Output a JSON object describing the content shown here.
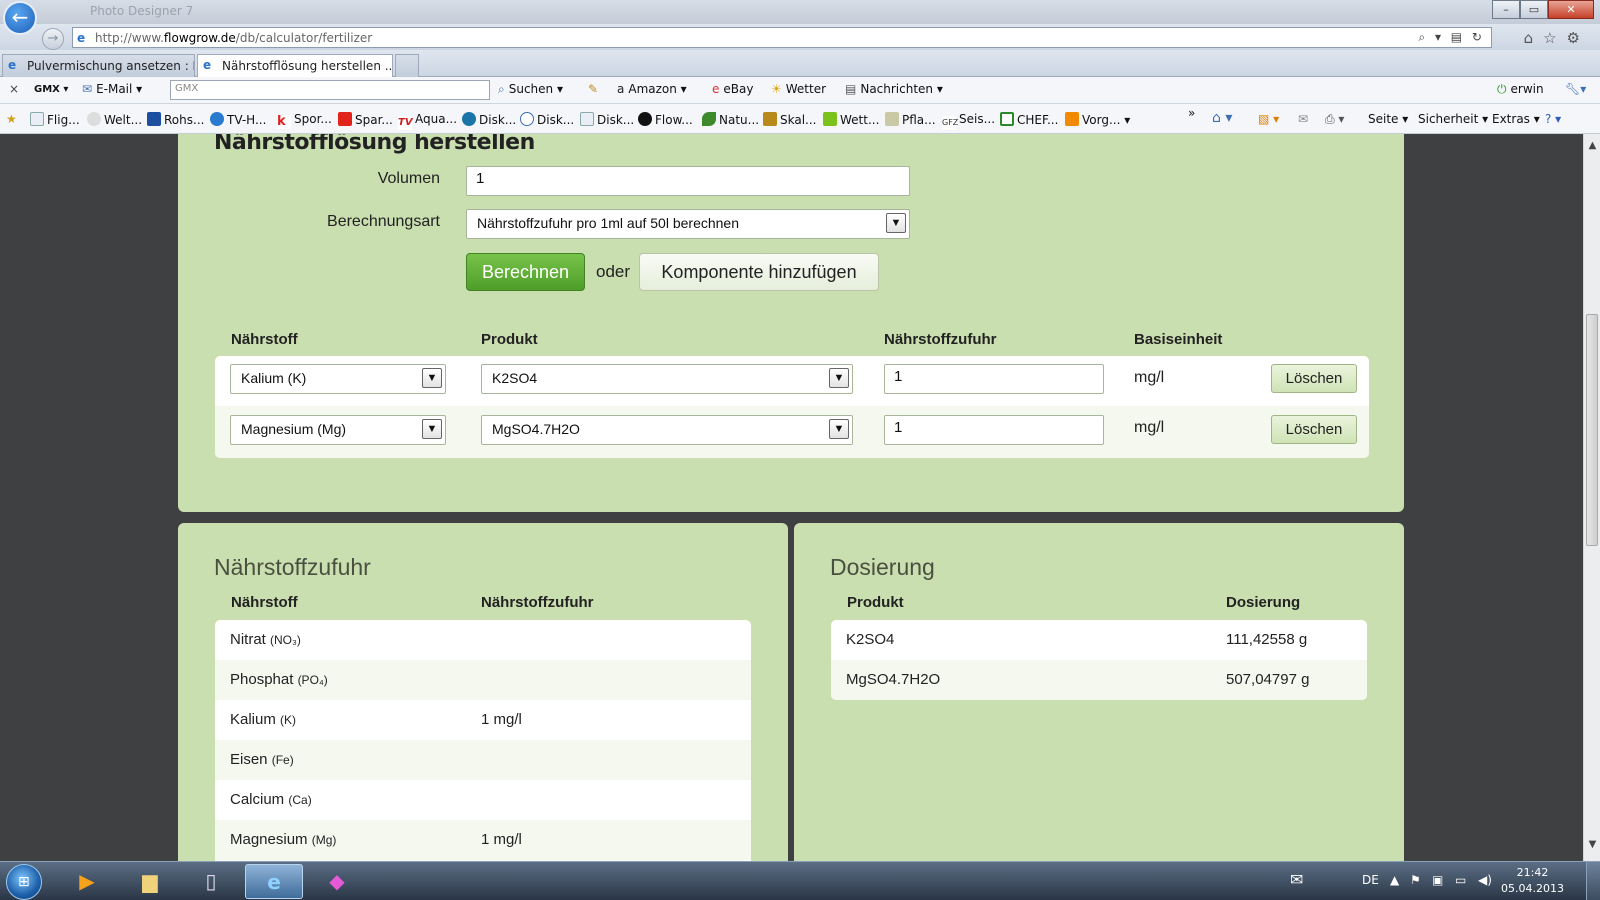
{
  "window": {
    "title": "Photo Designer 7"
  },
  "browser": {
    "url_prefix": "http://www.",
    "url_domain": "flowgrow.de",
    "url_path": "/db/calculator/fertilizer",
    "url_tools": "⌕ ▾ ▤ ↻",
    "tabs": [
      {
        "label": "Pulvermischung ansetzen : Nä...",
        "active": false
      },
      {
        "label": "Nährstofflösung herstellen ...",
        "active": true,
        "close": "×"
      }
    ],
    "toolbar": {
      "close": "×",
      "gmx": "GMX ▾",
      "email": "E-Mail",
      "search_placeholder": "GMX",
      "suchen": "Suchen",
      "amazon": "Amazon",
      "ebay": "eBay",
      "wetter": "Wetter",
      "nachrichten": "Nachrichten",
      "user": "erwin"
    },
    "favorites": [
      "Flig...",
      "Welt...",
      "Rohs...",
      "TV-H...",
      "Spor...",
      "Spar...",
      "Aqua...",
      "Disk...",
      "Disk...",
      "Disk...",
      "Flow...",
      "Natu...",
      "Skal...",
      "Wett...",
      "Pfla...",
      "Seis...",
      "CHEF...",
      "Vorg..."
    ],
    "favorites_more": "»",
    "command_menu": {
      "seite": "Seite ▾",
      "sicherheit": "Sicherheit ▾",
      "extras": "Extras ▾"
    }
  },
  "page": {
    "title": "Nährstofflösung herstellen",
    "form": {
      "volumen_label": "Volumen",
      "volumen_value": "1",
      "berechnungsart_label": "Berechnungsart",
      "berechnungsart_value": "Nährstoffzufuhr pro 1ml auf 50l berechnen",
      "berechnen_button": "Berechnen",
      "oder": "oder",
      "add_button": "Komponente hinzufügen"
    },
    "components": {
      "headers": [
        "Nährstoff",
        "Produkt",
        "Nährstoffzufuhr",
        "Basiseinheit"
      ],
      "rows": [
        {
          "naehrstoff": "Kalium (K)",
          "produkt": "K2SO4",
          "zufuhr": "1",
          "einheit": "mg/l",
          "delete": "Löschen"
        },
        {
          "naehrstoff": "Magnesium (Mg)",
          "produkt": "MgSO4.7H2O",
          "zufuhr": "1",
          "einheit": "mg/l",
          "delete": "Löschen"
        }
      ]
    },
    "zufuhr_section": {
      "title": "Nährstoffzufuhr",
      "headers": [
        "Nährstoff",
        "Nährstoffzufuhr"
      ],
      "rows": [
        {
          "name": "Nitrat",
          "formula": "(NO₃)",
          "value": ""
        },
        {
          "name": "Phosphat",
          "formula": "(PO₄)",
          "value": ""
        },
        {
          "name": "Kalium",
          "formula": "(K)",
          "value": "1 mg/l"
        },
        {
          "name": "Eisen",
          "formula": "(Fe)",
          "value": ""
        },
        {
          "name": "Calcium",
          "formula": "(Ca)",
          "value": ""
        },
        {
          "name": "Magnesium",
          "formula": "(Mg)",
          "value": "1 mg/l"
        }
      ]
    },
    "dosierung_section": {
      "title": "Dosierung",
      "headers": [
        "Produkt",
        "Dosierung"
      ],
      "rows": [
        {
          "produkt": "K2SO4",
          "dosierung": "111,42558 g"
        },
        {
          "produkt": "MgSO4.7H2O",
          "dosierung": "507,04797 g"
        }
      ]
    }
  },
  "taskbar": {
    "language": "DE",
    "time": "21:42",
    "date": "05.04.2013"
  },
  "colors": {
    "panel": "#cadfb0",
    "button_green": "#5aa934",
    "text": "#222222"
  }
}
